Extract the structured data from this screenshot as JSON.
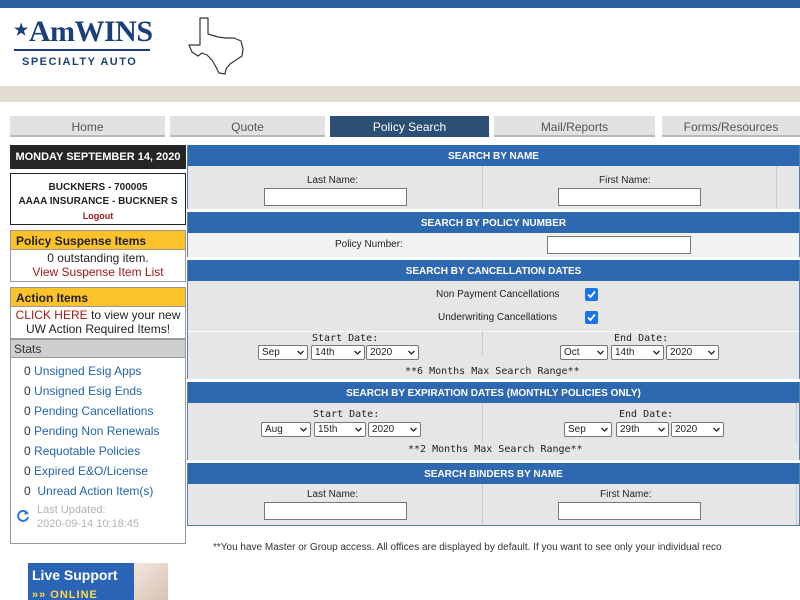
{
  "header": {
    "logo_main": "AmWINS",
    "logo_sub": "SPECIALTY AUTO"
  },
  "nav": {
    "tabs": [
      {
        "label": "Home",
        "active": false
      },
      {
        "label": "Quote",
        "active": false
      },
      {
        "label": "Policy Search",
        "active": true
      },
      {
        "label": "Mail/Reports",
        "active": false
      },
      {
        "label": "Forms/Resources",
        "active": false
      }
    ]
  },
  "sidebar": {
    "date": "MONDAY SEPTEMBER 14, 2020",
    "user": {
      "line1": "BUCKNERS - 700005",
      "line2": "AAAA INSURANCE - BUCKNER S",
      "logout": "Logout"
    },
    "suspense": {
      "title": "Policy Suspense Items",
      "count_text": "0 outstanding item.",
      "link": "View Suspense Item List"
    },
    "action": {
      "title": "Action Items",
      "link": "CLICK HERE",
      "text": "to view your new UW Action Required Items!"
    },
    "stats": {
      "title": "Stats",
      "items": [
        {
          "count": "0",
          "label": "Unsigned Esig Apps"
        },
        {
          "count": "0",
          "label": "Unsigned Esig Ends"
        },
        {
          "count": "0",
          "label": "Pending Cancellations"
        },
        {
          "count": "0",
          "label": "Pending Non Renewals"
        },
        {
          "count": "0",
          "label": "Requotable Policies"
        },
        {
          "count": "0",
          "label": "Expired E&O/License"
        },
        {
          "count": "0",
          "label": "Unread Action Item(s)"
        }
      ],
      "updated_label": "Last Updated:",
      "updated_value": "2020-09-14 10:18:45"
    }
  },
  "search_by_name": {
    "title": "SEARCH BY NAME",
    "last_name_label": "Last Name:",
    "first_name_label": "First Name:",
    "last_name_value": "",
    "first_name_value": ""
  },
  "search_by_policy": {
    "title": "SEARCH BY POLICY NUMBER",
    "policy_label": "Policy Number:",
    "policy_value": ""
  },
  "search_by_cancellation": {
    "title": "SEARCH BY CANCELLATION DATES",
    "nonpay_label": "Non Payment Cancellations",
    "nonpay_checked": true,
    "uw_label": "Underwriting Cancellations",
    "uw_checked": true,
    "start_label": "Start Date:",
    "end_label": "End Date:",
    "start_month": "Sep",
    "start_day": "14th",
    "start_year": "2020",
    "end_month": "Oct",
    "end_day": "14th",
    "end_year": "2020",
    "note": "**6 Months Max Search Range**"
  },
  "search_by_expiration": {
    "title": "SEARCH BY EXPIRATION DATES (MONTHLY POLICIES ONLY)",
    "start_label": "Start Date:",
    "end_label": "End Date:",
    "start_month": "Aug",
    "start_day": "15th",
    "start_year": "2020",
    "end_month": "Sep",
    "end_day": "29th",
    "end_year": "2020",
    "note": "**2 Months Max Search Range**"
  },
  "search_binders": {
    "title": "SEARCH BINDERS BY NAME",
    "last_name_label": "Last Name:",
    "first_name_label": "First Name:",
    "last_name_value": "",
    "first_name_value": ""
  },
  "footer_note": "**You have Master or Group access. All offices are displayed by default. If you want to see only your individual reco",
  "live_support": {
    "title": "Live Support",
    "status": "ONLINE"
  },
  "colors": {
    "brand_blue": "#1b3f7a",
    "section_blue": "#2e68b0",
    "active_tab": "#2c4f75",
    "panel_yellow": "#fcc22a",
    "link_red": "#a01818",
    "link_blue": "#2364aa"
  }
}
